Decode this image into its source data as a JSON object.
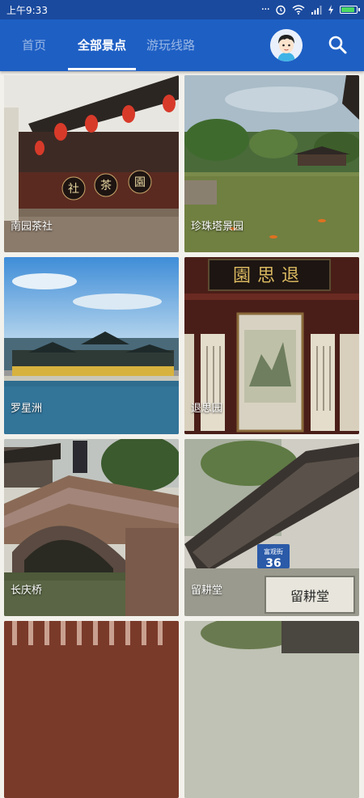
{
  "status_bar": {
    "time": "上午9:33",
    "dots": "···",
    "icons": [
      "alarm-icon",
      "wifi-icon",
      "signal-icon",
      "charging-icon",
      "battery-icon"
    ],
    "battery_level": 0.95,
    "background": "#1a4a9e"
  },
  "app_bar": {
    "background": "#1e5fc4",
    "tabs": [
      {
        "label": "首页",
        "active": false
      },
      {
        "label": "全部景点",
        "active": true
      },
      {
        "label": "游玩线路",
        "active": false
      }
    ],
    "avatar": "avatar-icon",
    "search": "search-icon"
  },
  "spots": [
    {
      "name": "南园茶社"
    },
    {
      "name": "珍珠塔景园"
    },
    {
      "name": "罗星洲"
    },
    {
      "name": "退思园"
    },
    {
      "name": "长庆桥"
    },
    {
      "name": "留耕堂"
    },
    {
      "name": ""
    },
    {
      "name": ""
    }
  ],
  "scene_text": {
    "teahouse_sign": [
      "社",
      "茶",
      "園"
    ],
    "tuisi_plaque": "園思退",
    "street_sign": "富观街",
    "house_number": "36",
    "liugeng_plaque": "留耕堂"
  }
}
